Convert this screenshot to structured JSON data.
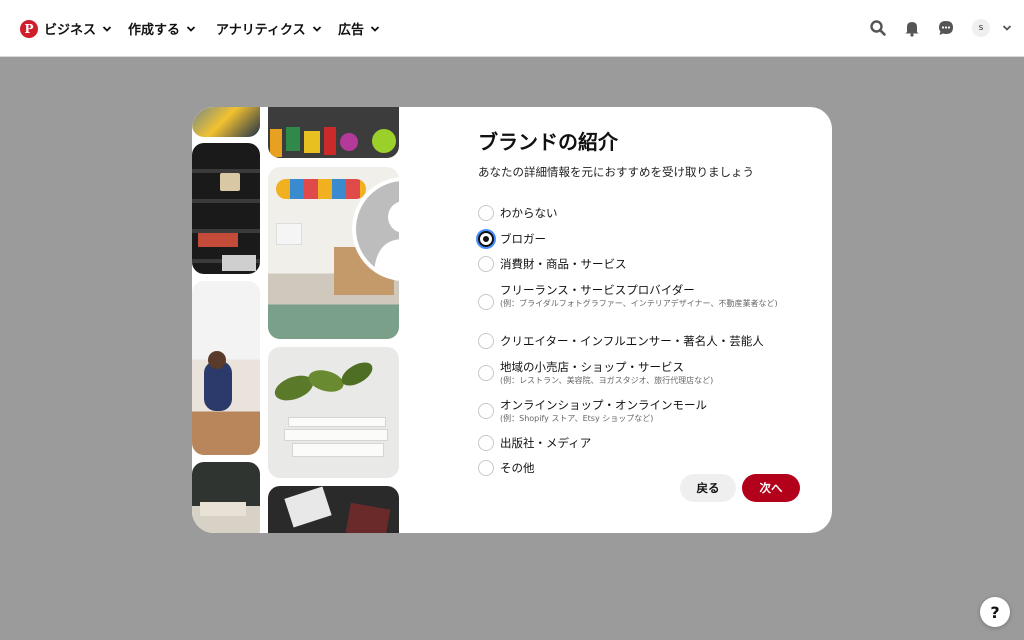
{
  "nav": {
    "logo_letter": "P",
    "business_label": "ビジネス",
    "create_label": "作成する",
    "analytics_label": "アナリティクス",
    "ads_label": "広告",
    "avatar_letter": "s"
  },
  "modal": {
    "title": "ブランドの紹介",
    "subtitle": "あなたの詳細情報を元におすすめを受け取りましょう",
    "options": [
      {
        "label": "わからない",
        "hint": "",
        "selected": false
      },
      {
        "label": "ブロガー",
        "hint": "",
        "selected": true
      },
      {
        "label": "消費財・商品・サービス",
        "hint": "",
        "selected": false
      },
      {
        "label": "フリーランス・サービスプロバイダー",
        "hint": "(例：ブライダルフォトグラファー、インテリアデザイナー、不動産業者など)",
        "selected": false
      },
      {
        "label": "クリエイター・インフルエンサー・著名人・芸能人",
        "hint": "",
        "selected": false
      },
      {
        "label": "地域の小売店・ショップ・サービス",
        "hint": "(例：レストラン、美容院、ヨガスタジオ、旅行代理店など)",
        "selected": false
      },
      {
        "label": "オンラインショップ・オンラインモール",
        "hint": "(例：Shopify ストア、Etsy ショップなど)",
        "selected": false
      },
      {
        "label": "出版社・メディア",
        "hint": "",
        "selected": false
      },
      {
        "label": "その他",
        "hint": "",
        "selected": false
      }
    ],
    "back_label": "戻る",
    "next_label": "次へ"
  },
  "help_label": "?",
  "colors": {
    "brand_red": "#b3001b",
    "logo_red": "#d01f2a",
    "overlay": "#9b9b9b",
    "focus_ring": "#4a8fff"
  }
}
